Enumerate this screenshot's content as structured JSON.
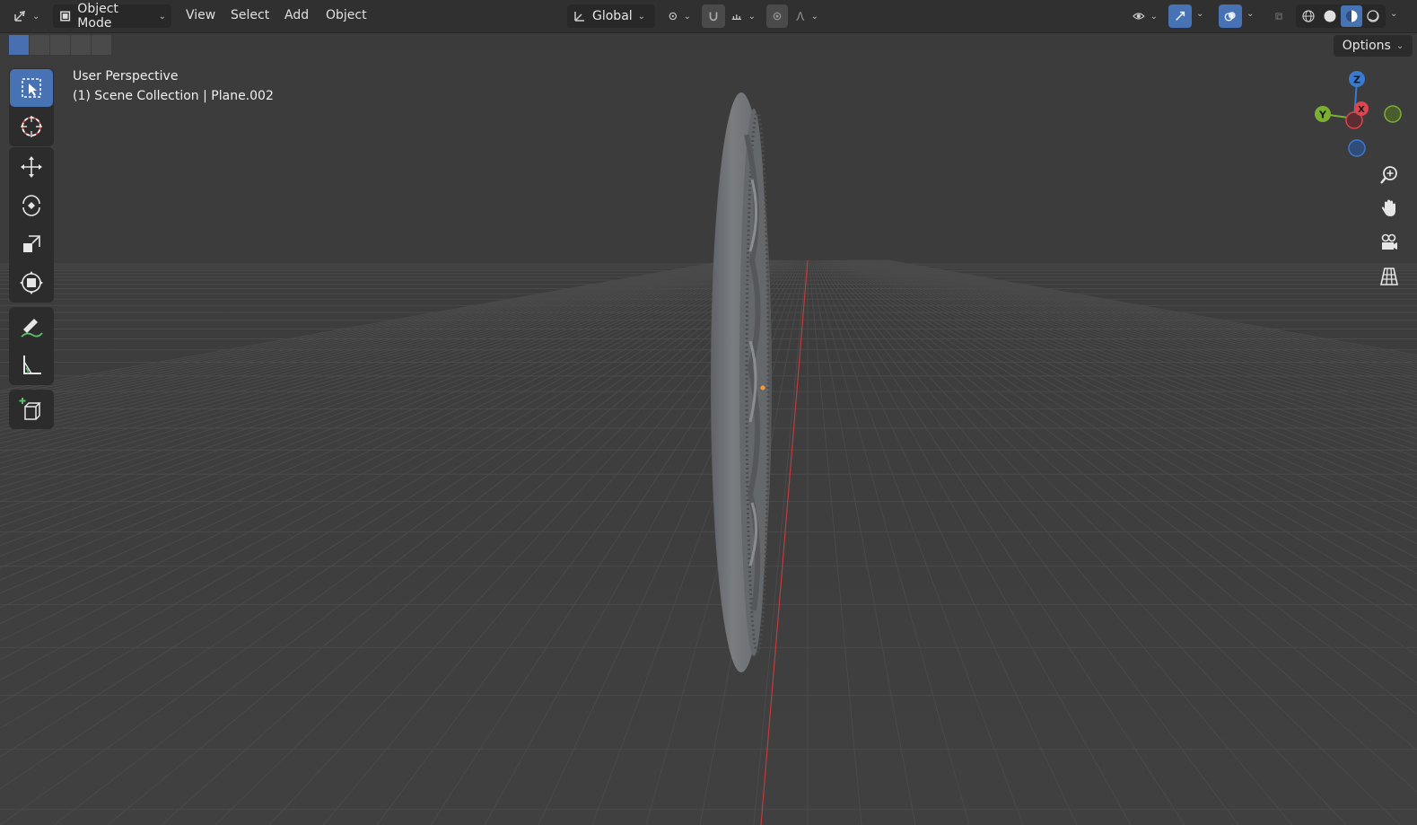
{
  "header": {
    "mode_label": "Object Mode",
    "menu": [
      "View",
      "Select",
      "Add",
      "Object"
    ],
    "orientation_label": "Global"
  },
  "viewport": {
    "perspective_label": "User Perspective",
    "collection_label": "(1) Scene Collection | Plane.002",
    "options_label": "Options"
  },
  "gizmo": {
    "z_label": "Z",
    "y_label": "Y",
    "x_label": "X"
  },
  "toolbar": {
    "tools": [
      "select-box-icon",
      "cursor-icon",
      "move-icon",
      "rotate-icon",
      "scale-icon",
      "transform-icon",
      "annotate-icon",
      "measure-icon",
      "add-cube-icon"
    ]
  },
  "colors": {
    "accent": "#4772b3",
    "x_axis": "#e0444e",
    "y_axis": "#7ab032",
    "z_axis": "#3a7ad1",
    "background": "#3d3d3d"
  }
}
